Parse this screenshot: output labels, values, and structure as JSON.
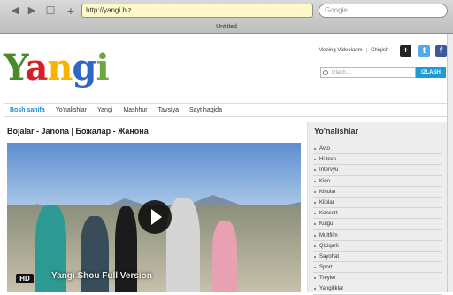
{
  "browser": {
    "address": "http://yangi.biz",
    "search_placeholder": "Google",
    "tab_title": "Untitled",
    "nav_back": "◀",
    "nav_forward": "▶",
    "bookmarks_icon": "book-icon",
    "add_tab": "+"
  },
  "header": {
    "logo": [
      "Y",
      "a",
      "n",
      "g",
      "i"
    ],
    "my_videos": "Mening Videolarim",
    "separator": "|",
    "logout": "Chiqish",
    "search_placeholder": "Izlash....",
    "search_button": "IZLASH"
  },
  "nav": {
    "items": [
      "Bosh sahifa",
      "Yo'nalishlar",
      "Yangi",
      "Mashhur",
      "Tavsiya",
      "Sayt haqida"
    ]
  },
  "main": {
    "title": "Bojalar - Janona | Божалар - Жанона",
    "hd": "HD",
    "watermark": "Yangi Shou\nFull Version"
  },
  "sidebar": {
    "title": "Yo'nalishlar",
    "items": [
      "Avto",
      "Hi-tech",
      "Intervyu",
      "Kino",
      "Kinolar",
      "Kliplar",
      "Konsert",
      "Kulgu",
      "Multfilm",
      "Qiziqarli",
      "Sayohat",
      "Sport",
      "Treyler",
      "Yangiliklar"
    ]
  },
  "colors": {
    "accent": "#1c9bd5",
    "address_bar": "#fff8c9"
  }
}
